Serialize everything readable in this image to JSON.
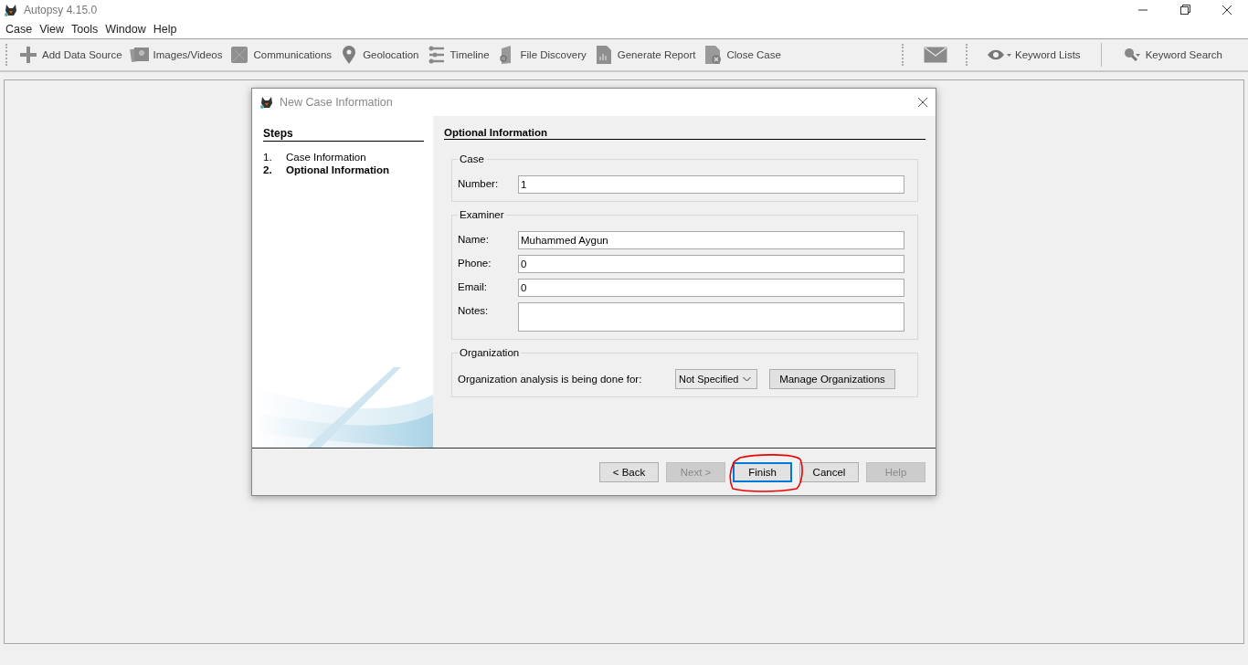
{
  "window": {
    "title": "Autopsy 4.15.0"
  },
  "menu": [
    "Case",
    "View",
    "Tools",
    "Window",
    "Help"
  ],
  "toolbar": [
    {
      "label": "Add Data Source"
    },
    {
      "label": "Images/Videos"
    },
    {
      "label": "Communications"
    },
    {
      "label": "Geolocation"
    },
    {
      "label": "Timeline"
    },
    {
      "label": "File Discovery"
    },
    {
      "label": "Generate Report"
    },
    {
      "label": "Close Case"
    }
  ],
  "toolbar_right": [
    {
      "label": "Keyword Lists"
    },
    {
      "label": "Keyword Search"
    }
  ],
  "dialog": {
    "title": "New Case Information",
    "steps_heading": "Steps",
    "steps": [
      {
        "number": "1.",
        "label": "Case Information",
        "selected": false
      },
      {
        "number": "2.",
        "label": "Optional Information",
        "selected": true
      }
    ],
    "heading": "Optional Information",
    "groups": [
      {
        "legend": "Case",
        "fields": [
          {
            "label": "Number:",
            "value": "1",
            "kind": "line"
          }
        ]
      },
      {
        "legend": "Examiner",
        "fields": [
          {
            "label": "Name:",
            "value": "Muhammed Aygun",
            "kind": "line"
          },
          {
            "label": "Phone:",
            "value": "0",
            "kind": "line"
          },
          {
            "label": "Email:",
            "value": "0",
            "kind": "line"
          },
          {
            "label": "Notes:",
            "kind": "area"
          }
        ]
      }
    ],
    "organization": {
      "legend": "Organization",
      "label": "Organization analysis is being done for:",
      "dropdown": "Not Specified",
      "button": "Manage Organizations"
    },
    "buttons": [
      {
        "label": "< Back",
        "disabled": false,
        "focused": false
      },
      {
        "label": "Next >",
        "disabled": true,
        "focused": false
      },
      {
        "label": "Finish",
        "disabled": false,
        "focused": true
      },
      {
        "label": "Cancel",
        "disabled": false,
        "focused": false
      },
      {
        "label": "Help",
        "disabled": true,
        "focused": false
      }
    ]
  }
}
